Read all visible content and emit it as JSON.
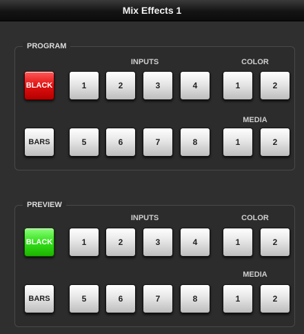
{
  "window": {
    "title": "Mix Effects 1"
  },
  "program": {
    "label": "PROGRAM",
    "inputs_label": "INPUTS",
    "color_label": "COLOR",
    "media_label": "MEDIA",
    "row1": {
      "black": "BLACK",
      "inputs": [
        "1",
        "2",
        "3",
        "4"
      ],
      "colors": [
        "1",
        "2"
      ]
    },
    "row2": {
      "bars": "BARS",
      "inputs": [
        "5",
        "6",
        "7",
        "8"
      ],
      "media": [
        "1",
        "2"
      ]
    },
    "active_color": "#e01010"
  },
  "preview": {
    "label": "PREVIEW",
    "inputs_label": "INPUTS",
    "color_label": "COLOR",
    "media_label": "MEDIA",
    "row1": {
      "black": "BLACK",
      "inputs": [
        "1",
        "2",
        "3",
        "4"
      ],
      "colors": [
        "1",
        "2"
      ]
    },
    "row2": {
      "bars": "BARS",
      "inputs": [
        "5",
        "6",
        "7",
        "8"
      ],
      "media": [
        "1",
        "2"
      ]
    },
    "active_color": "#33e01a"
  }
}
